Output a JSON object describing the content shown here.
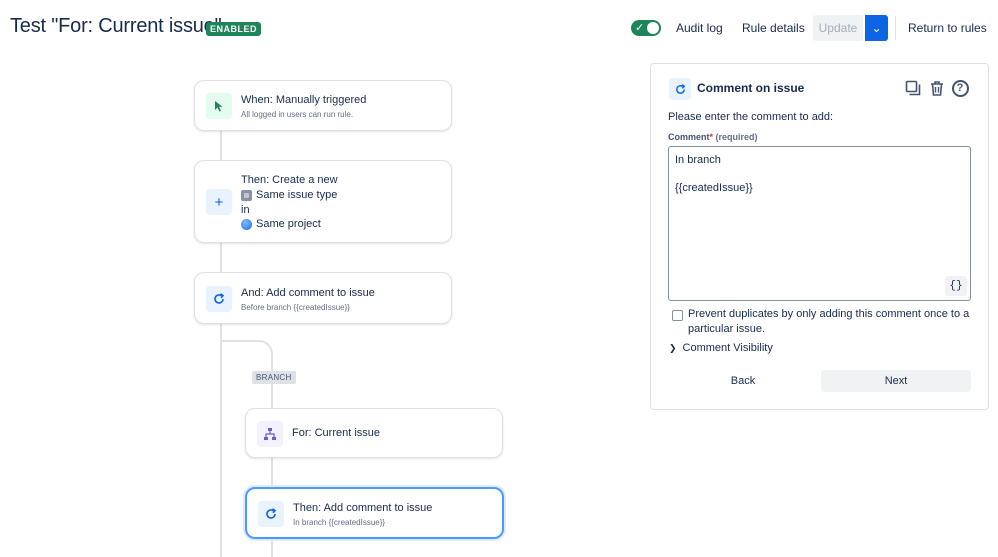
{
  "header": {
    "title": "Test \"For: Current issue\"",
    "status_badge": "ENABLED",
    "toggle_on": true,
    "audit_log": "Audit log",
    "rule_details": "Rule details",
    "update": "Update",
    "return_to_rules": "Return to rules"
  },
  "flow": {
    "trigger": {
      "title": "When: Manually triggered",
      "subtitle": "All logged in users can run rule."
    },
    "create": {
      "line1": "Then: Create a new",
      "line2": "Same issue type",
      "line3": "in",
      "line4": "Same project"
    },
    "comment_before": {
      "title": "And: Add comment to issue",
      "subtitle": "Before branch {{createdIssue}}"
    },
    "branch_label": "BRANCH",
    "branch": {
      "title": "For: Current issue"
    },
    "comment_in": {
      "title": "Then: Add comment to issue",
      "subtitle": "In branch {{createdIssue}}"
    }
  },
  "panel": {
    "title": "Comment on issue",
    "intro": "Please enter the comment to add:",
    "field_label": "Comment",
    "required_mark": "*",
    "required_text": "(required)",
    "comment_value": "In branch\n\n{{createdIssue}}",
    "smart_values": "{}",
    "prevent_duplicates": "Prevent duplicates by only adding this comment once to a particular issue.",
    "prevent_duplicates_checked": false,
    "comment_visibility": "Comment Visibility",
    "back": "Back",
    "next": "Next"
  },
  "colors": {
    "enabled_green": "#1f845a",
    "primary_blue": "#0c66e4",
    "selected_border": "#4c9aff"
  },
  "icons": {
    "trigger": "cursor-click-icon",
    "create": "plus-icon",
    "comment": "comment-refresh-icon",
    "branch": "hierarchy-icon",
    "copy": "copy-icon",
    "delete": "trash-icon",
    "help": "help-icon"
  }
}
